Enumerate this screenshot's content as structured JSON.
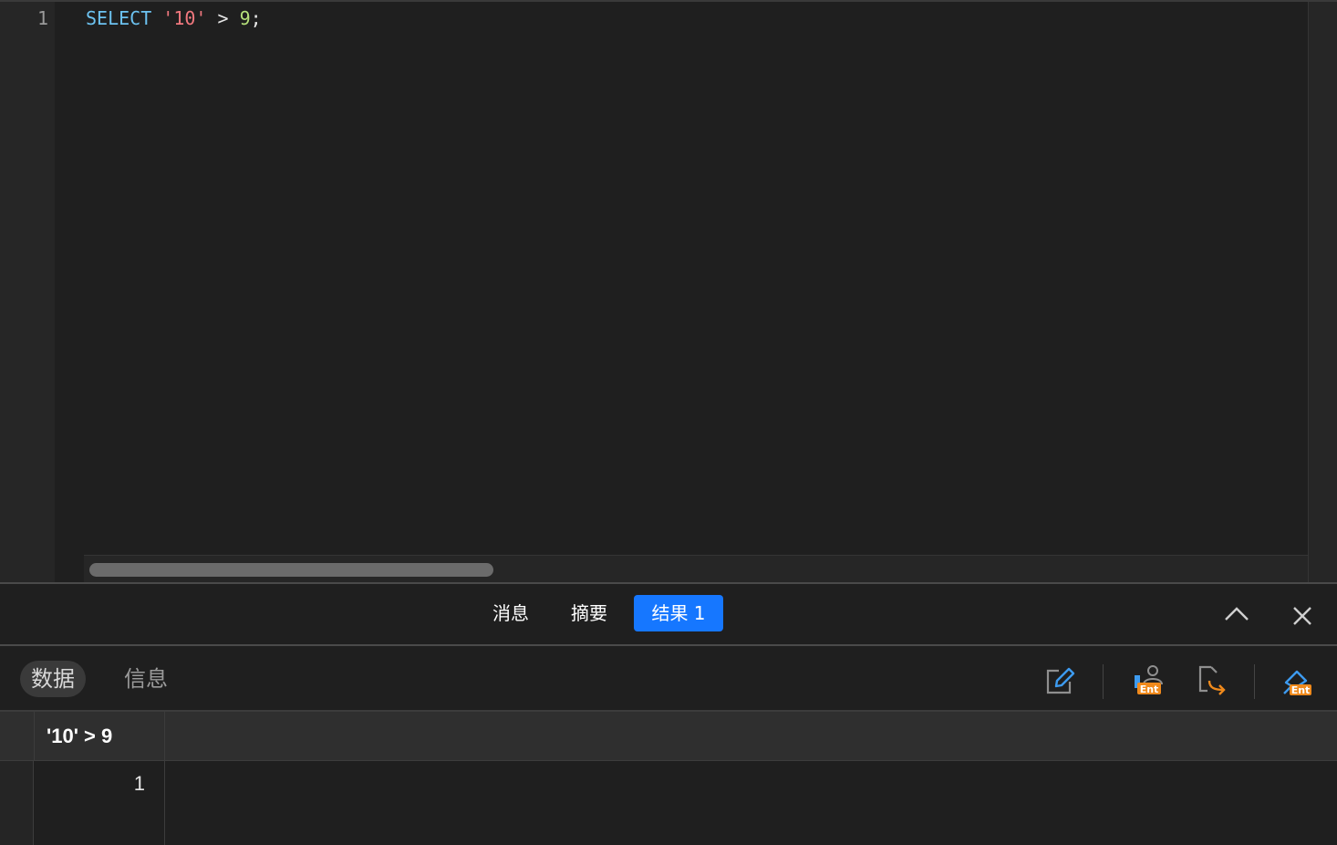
{
  "editor": {
    "line_numbers": [
      "1"
    ],
    "code": {
      "keyword": "SELECT",
      "string": "'10'",
      "operator": ">",
      "number": "9",
      "terminator": ";"
    }
  },
  "result_tabs": [
    {
      "label": "消息",
      "active": false
    },
    {
      "label": "摘要",
      "active": false
    },
    {
      "label": "结果 1",
      "active": true
    }
  ],
  "sub_tabs": [
    {
      "label": "数据",
      "active": true
    },
    {
      "label": "信息",
      "active": false
    }
  ],
  "toolbar": {
    "icons": [
      "edit-icon",
      "enterprise-user-icon",
      "export-icon",
      "enterprise-pin-icon"
    ],
    "badge_text": "Ent",
    "badge_color": "#f08a1c",
    "icon_color": "#3d9bf0"
  },
  "grid": {
    "columns": [
      "'10' > 9"
    ],
    "rows": [
      [
        "1"
      ]
    ]
  },
  "colors": {
    "accent": "#1677ff",
    "keyword": "#6cc2f0",
    "string": "#f1787e",
    "number": "#b5e07a"
  }
}
